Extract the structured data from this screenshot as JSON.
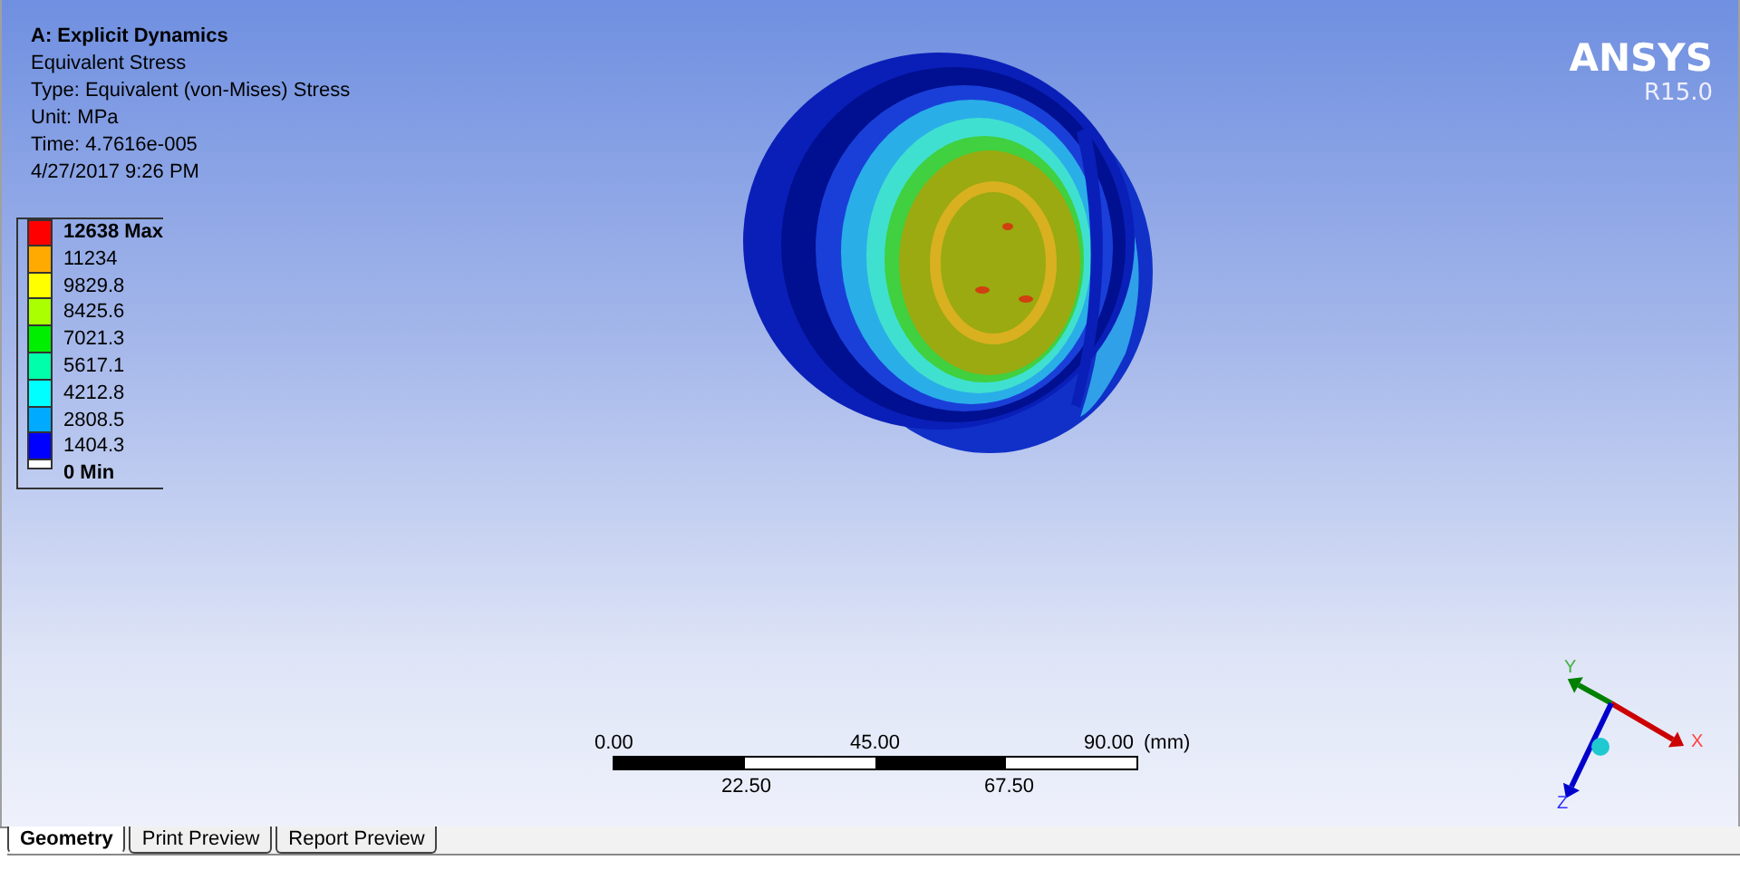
{
  "viewport": {
    "title": "A: Explicit Dynamics",
    "details": [
      "Equivalent Stress",
      "Type: Equivalent (von-Mises) Stress",
      "Unit: MPa",
      "Time: 4.7616e-005",
      "4/27/2017 9:26 PM"
    ],
    "legend": [
      {
        "label": "12638 Max",
        "color": "#ff0000",
        "kind": "max"
      },
      {
        "label": "11234",
        "color": "#ffaa00",
        "kind": "level"
      },
      {
        "label": "9829.8",
        "color": "#ffff00",
        "kind": "level"
      },
      {
        "label": "8425.6",
        "color": "#aaff00",
        "kind": "level"
      },
      {
        "label": "7021.3",
        "color": "#00ee00",
        "kind": "level"
      },
      {
        "label": "5617.1",
        "color": "#00ffaa",
        "kind": "level"
      },
      {
        "label": "4212.8",
        "color": "#00ffff",
        "kind": "level"
      },
      {
        "label": "2808.5",
        "color": "#00aaff",
        "kind": "level"
      },
      {
        "label": "1404.3",
        "color": "#0000ff",
        "kind": "level"
      },
      {
        "label": "0 Min",
        "color": "#ffffff",
        "kind": "min"
      }
    ],
    "logo": {
      "name": "ANSYS",
      "version": "R15.0"
    },
    "scale_bar": {
      "top_labels": [
        "0.00",
        "45.00",
        "90.00"
      ],
      "unit": "(mm)",
      "bottom_labels": [
        "22.50",
        "67.50"
      ]
    },
    "triad": {
      "axes": [
        "X",
        "Y",
        "Z"
      ]
    }
  },
  "tabs": [
    {
      "label": "Geometry",
      "selected": true
    },
    {
      "label": "Print Preview",
      "selected": false
    },
    {
      "label": "Report Preview",
      "selected": false
    }
  ]
}
